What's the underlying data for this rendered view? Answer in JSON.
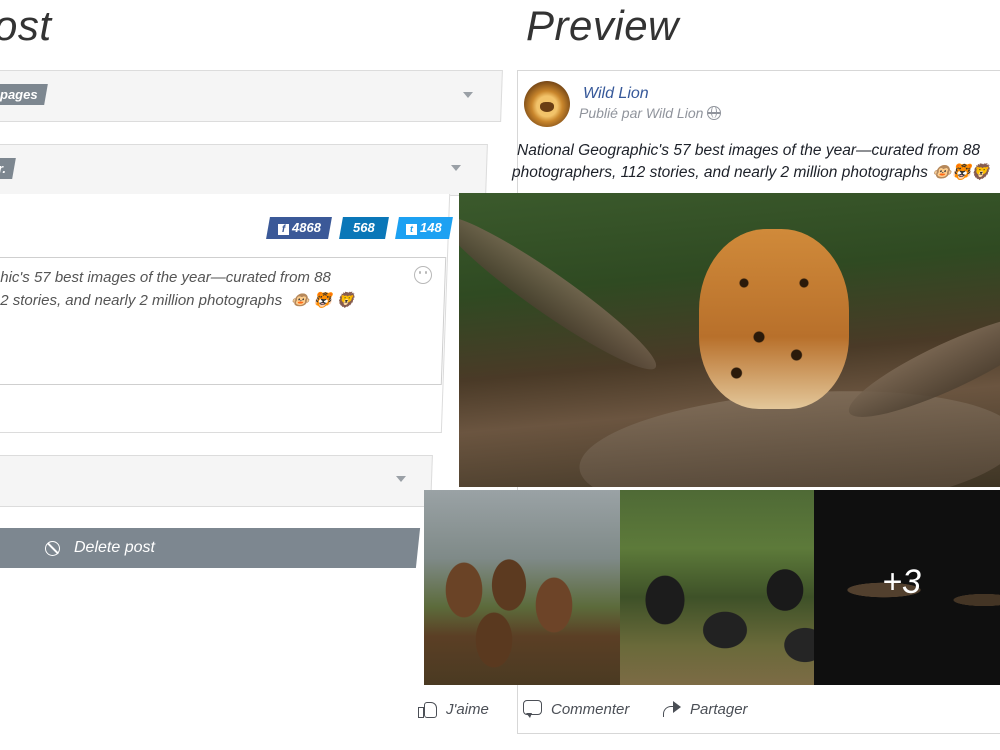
{
  "editor": {
    "title": "ost",
    "section1": {
      "tag": "pages"
    },
    "section2": {
      "tag": "r.",
      "shares": {
        "facebook": "4868",
        "linkedin": "568",
        "twitter": "148"
      },
      "message_line1": "hic's 57 best images of the year—curated from 88",
      "message_line2": "2 stories, and nearly 2 million photographs",
      "message_emojis": "🐵 🐯 🦁"
    },
    "delete_label": "Delete post"
  },
  "preview": {
    "title": "Preview",
    "page_name": "Wild Lion",
    "published_by": "Publié par Wild Lion",
    "text_line1": "National Geographic's 57 best images of the year—curated from 88",
    "text_line2": "photographers, 112 stories, and nearly 2 million photographs 🐵🐯🦁",
    "more_photos": "+3",
    "actions": {
      "like": "J'aime",
      "comment": "Commenter",
      "share": "Partager"
    }
  },
  "colors": {
    "tag_gray": "#7d8790",
    "facebook": "#3b5998",
    "linkedin": "#0a77b8",
    "twitter": "#1da1f2",
    "link_blue": "#365899"
  },
  "icons": [
    "chevron-down-icon",
    "facebook-icon",
    "twitter-icon",
    "smiley-icon",
    "ban-icon",
    "globe-icon",
    "like-icon",
    "comment-icon",
    "share-icon"
  ]
}
